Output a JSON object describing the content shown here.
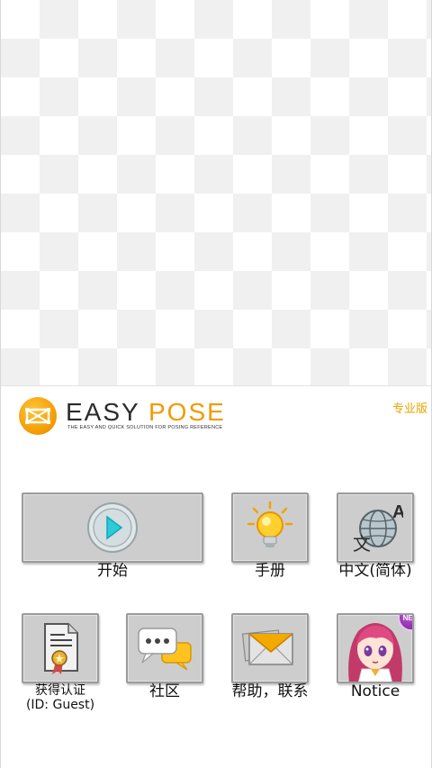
{
  "header": {
    "logo_title_left": "EASY",
    "logo_title_right": "POSE",
    "logo_tagline": "THE EASY AND QUICK SOLUTION FOR POSING REFERENCE",
    "pro_label": "专业版"
  },
  "menu": {
    "start": "开始",
    "manual": "手册",
    "language": "中文(简体)",
    "certify_line1": "获得认证",
    "certify_line2": "(ID: Guest)",
    "community": "社区",
    "help": "帮助，联系",
    "notice": "Notice",
    "new_badge": "NEW"
  },
  "colors": {
    "accent": "#f29a00",
    "pro": "#e7a400",
    "tile_bg": "#cdcdcd"
  }
}
